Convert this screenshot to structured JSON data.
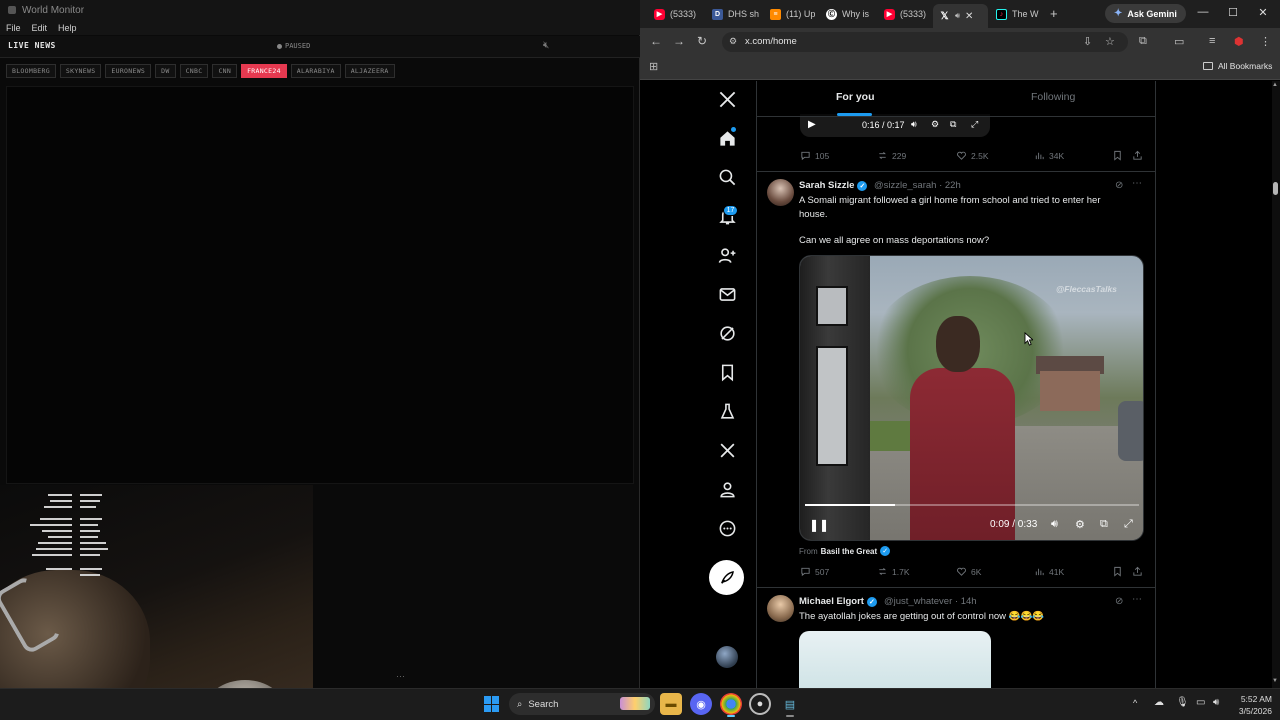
{
  "world_monitor": {
    "title": "World Monitor",
    "menu": [
      "File",
      "Edit",
      "Help"
    ],
    "panel_title": "LIVE NEWS",
    "status": "PAUSED",
    "channels": [
      "BLOOMBERG",
      "SKYNEWS",
      "EURONEWS",
      "DW",
      "CNBC",
      "CNN",
      "FRANCE24",
      "ALARABIYA",
      "ALJAZEERA"
    ],
    "active_channel": "FRANCE24",
    "accent_color": "#e53950"
  },
  "browser": {
    "tabs": [
      {
        "label": "(5333)",
        "icon": "youtube-icon"
      },
      {
        "label": "DHS sh",
        "icon": "dhs-icon"
      },
      {
        "label": "(11) Up",
        "icon": "substack-icon"
      },
      {
        "label": "Why is",
        "icon": "why-icon"
      },
      {
        "label": "(5333)",
        "icon": "youtube-icon"
      },
      {
        "label": "",
        "icon": "x-icon"
      },
      {
        "label": "The W",
        "icon": "tiktok-icon"
      }
    ],
    "ask_gemini": "Ask Gemini",
    "url": "x.com/home",
    "all_bookmarks": "All Bookmarks"
  },
  "x": {
    "tabs": {
      "for_you": "For you",
      "following": "Following"
    },
    "notifications_count": "17",
    "accent_color": "#1d9bf0",
    "prev_tweet": {
      "video_time": "0:16 / 0:17",
      "replies": "105",
      "reposts": "229",
      "likes": "2.5K",
      "views": "34K"
    },
    "tweet1": {
      "name": "Sarah Sizzle",
      "handle": "@sizzle_sarah",
      "time": "· 22h",
      "text_line1": "A Somali migrant followed a girl home from school and tried to enter her",
      "text_line2": "house.",
      "text_line3": "Can we all agree on mass deportations now?",
      "video_watermark": "@FleccasTalks",
      "video_time": "0:09 / 0:33",
      "video_progress": 0.27,
      "from_prefix": "From",
      "from_name": "Basil the Great",
      "replies": "507",
      "reposts": "1.7K",
      "likes": "6K",
      "views": "41K"
    },
    "tweet2": {
      "name": "Michael Elgort",
      "handle": "@just_whatever",
      "time": "· 14h",
      "text": "The ayatollah jokes are getting out of control now 😂😂😂"
    }
  },
  "taskbar": {
    "search_label": "Search",
    "time": "5:52 AM",
    "date": "3/5/2026"
  }
}
